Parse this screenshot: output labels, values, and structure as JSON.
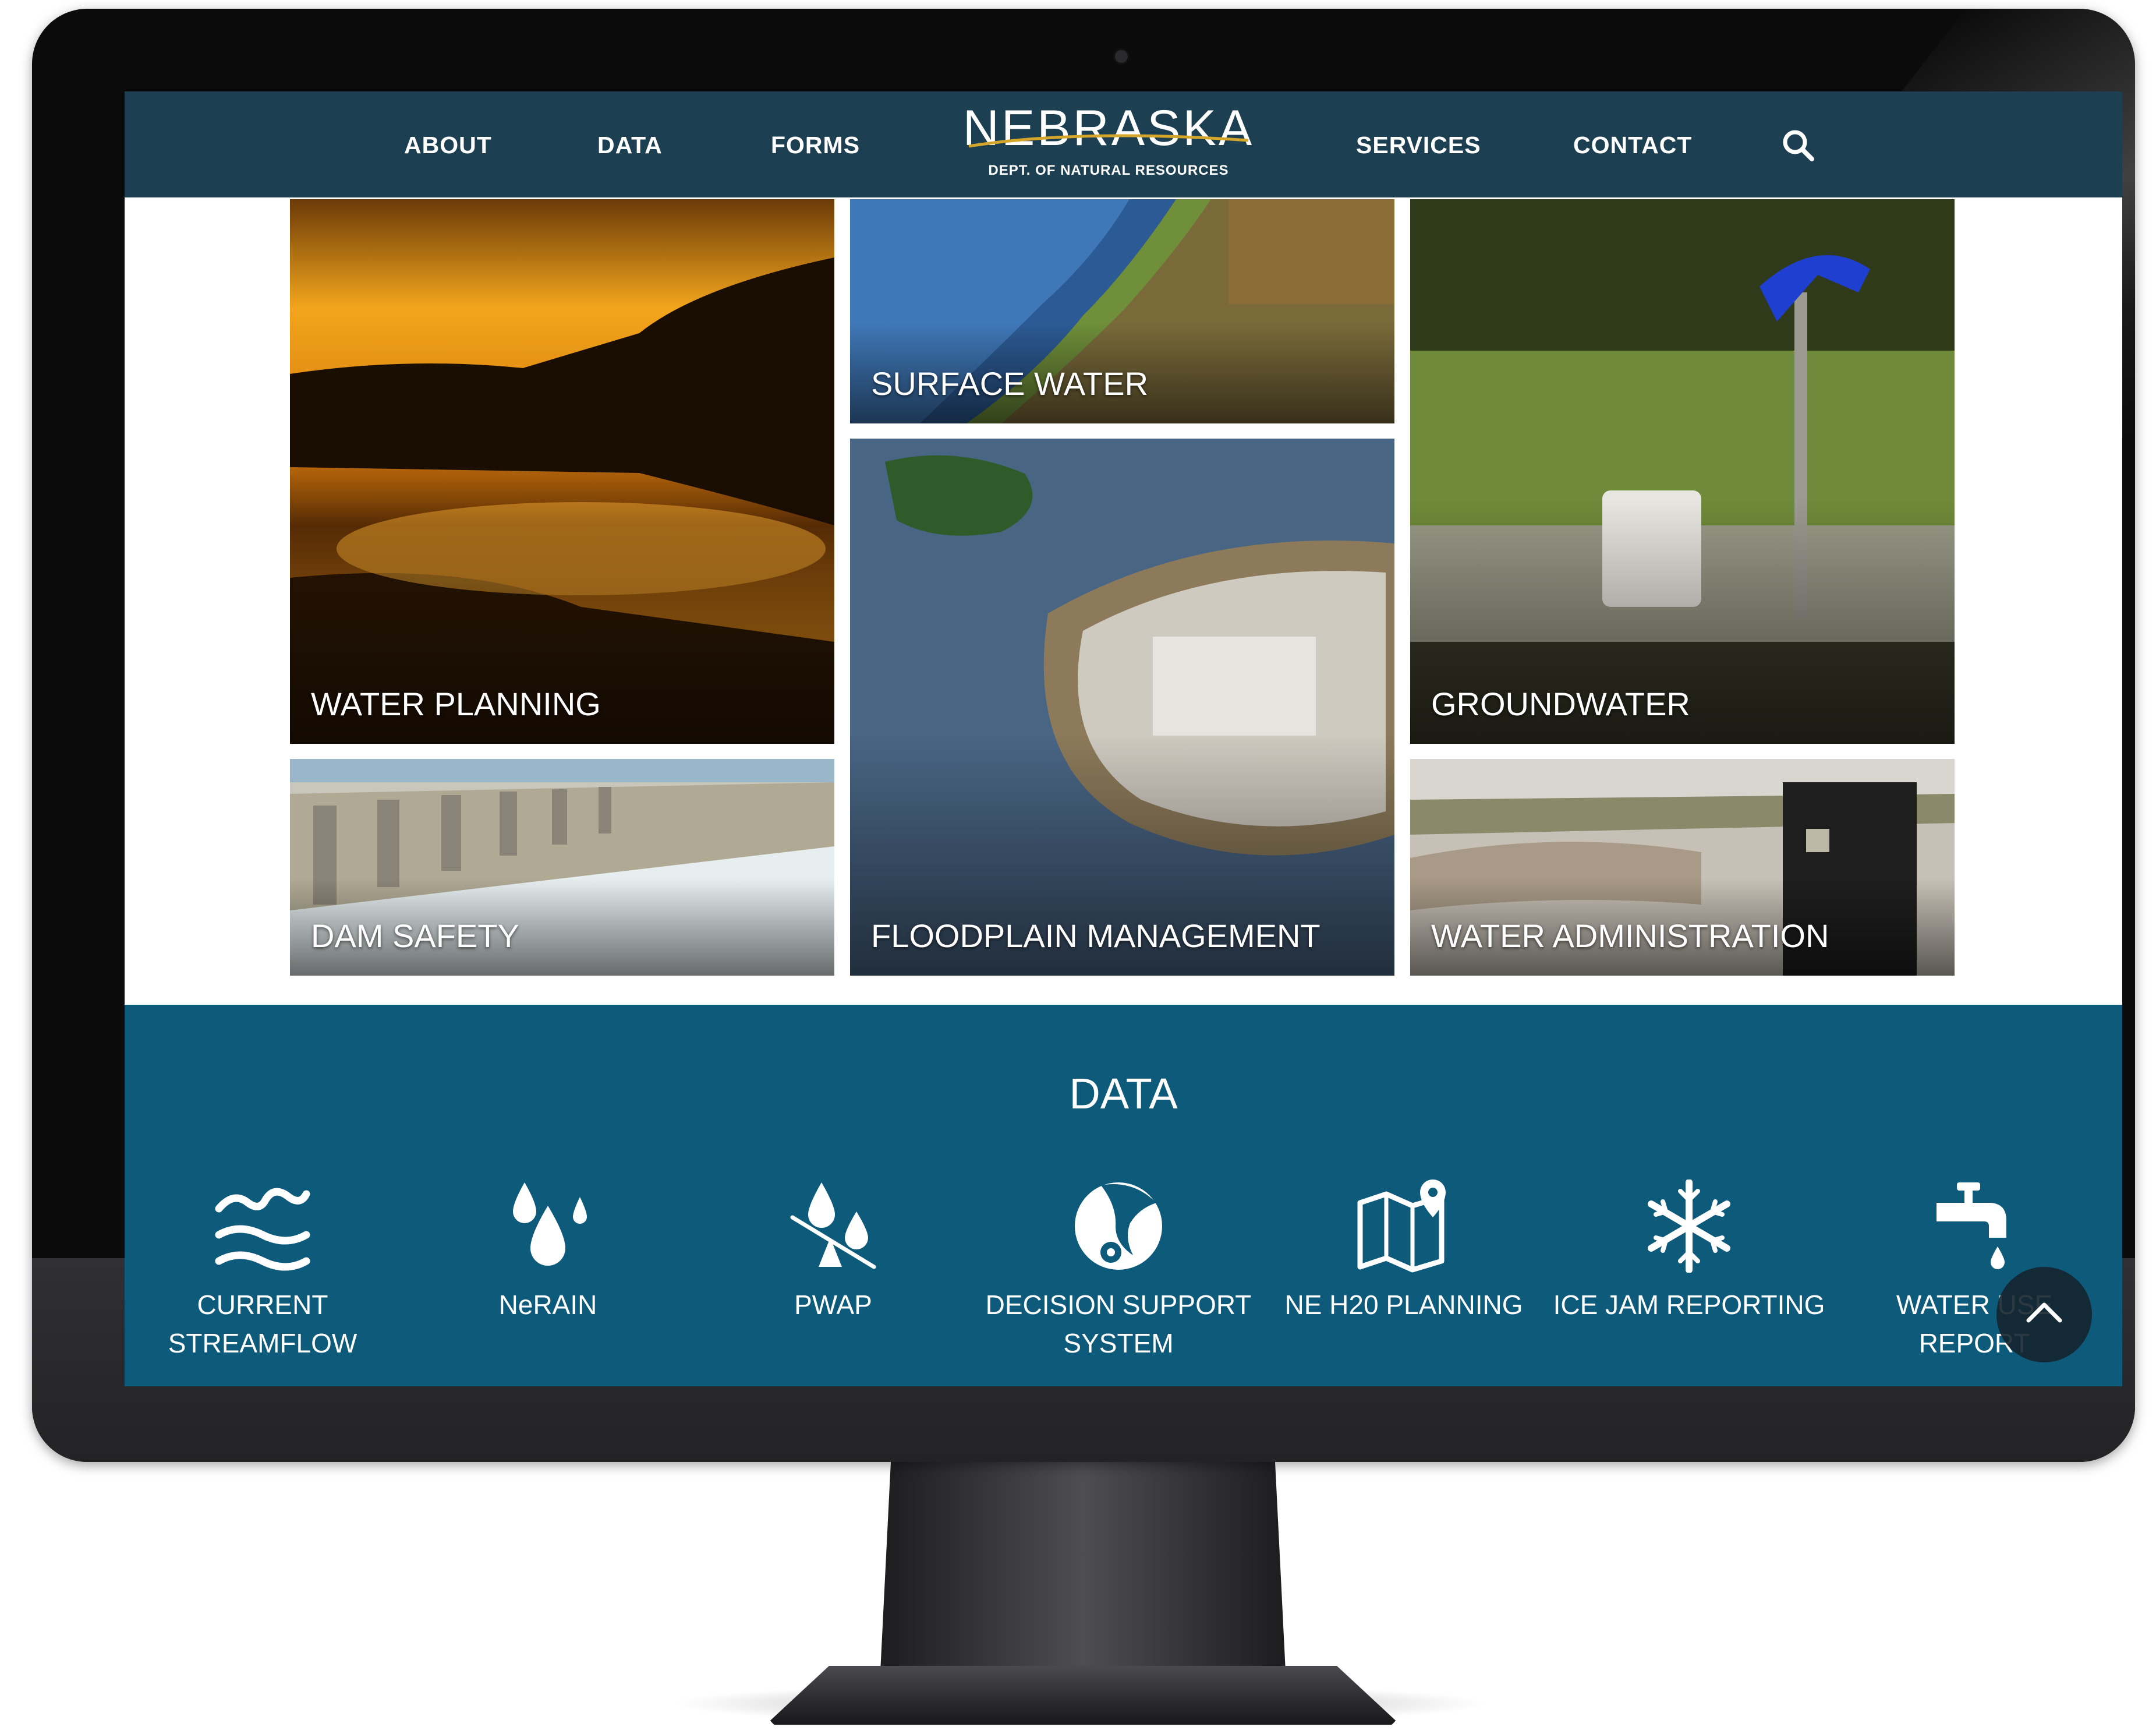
{
  "nav": {
    "links": [
      "ABOUT",
      "DATA",
      "FORMS",
      "SERVICES",
      "CONTACT"
    ],
    "logo_title": "NEBRASKA",
    "logo_subtitle": "DEPT. OF NATURAL RESOURCES",
    "search_icon": "search-icon"
  },
  "tiles": [
    {
      "label": "WATER PLANNING"
    },
    {
      "label": "SURFACE WATER"
    },
    {
      "label": "GROUNDWATER"
    },
    {
      "label": "DAM SAFETY"
    },
    {
      "label": "FLOODPLAIN MANAGEMENT"
    },
    {
      "label": "WATER ADMINISTRATION"
    }
  ],
  "data_section": {
    "title": "DATA",
    "items": [
      {
        "label": "CURRENT STREAMFLOW",
        "icon": "water-waves-icon"
      },
      {
        "label": "NeRAIN",
        "icon": "raindrops-icon"
      },
      {
        "label": "PWAP",
        "icon": "drops-balance-icon"
      },
      {
        "label": "DECISION SUPPORT SYSTEM",
        "icon": "river-map-pin-icon"
      },
      {
        "label": "NE H20 PLANNING",
        "icon": "folded-map-pin-icon"
      },
      {
        "label": "ICE JAM REPORTING",
        "icon": "snowflake-icon"
      },
      {
        "label": "WATER USE REPORT",
        "icon": "faucet-icon"
      }
    ],
    "scroll_top_icon": "chevron-up-icon"
  },
  "colors": {
    "nav_bg": "#1c3f52",
    "data_bg": "#0d5a7a",
    "text": "#ffffff"
  }
}
